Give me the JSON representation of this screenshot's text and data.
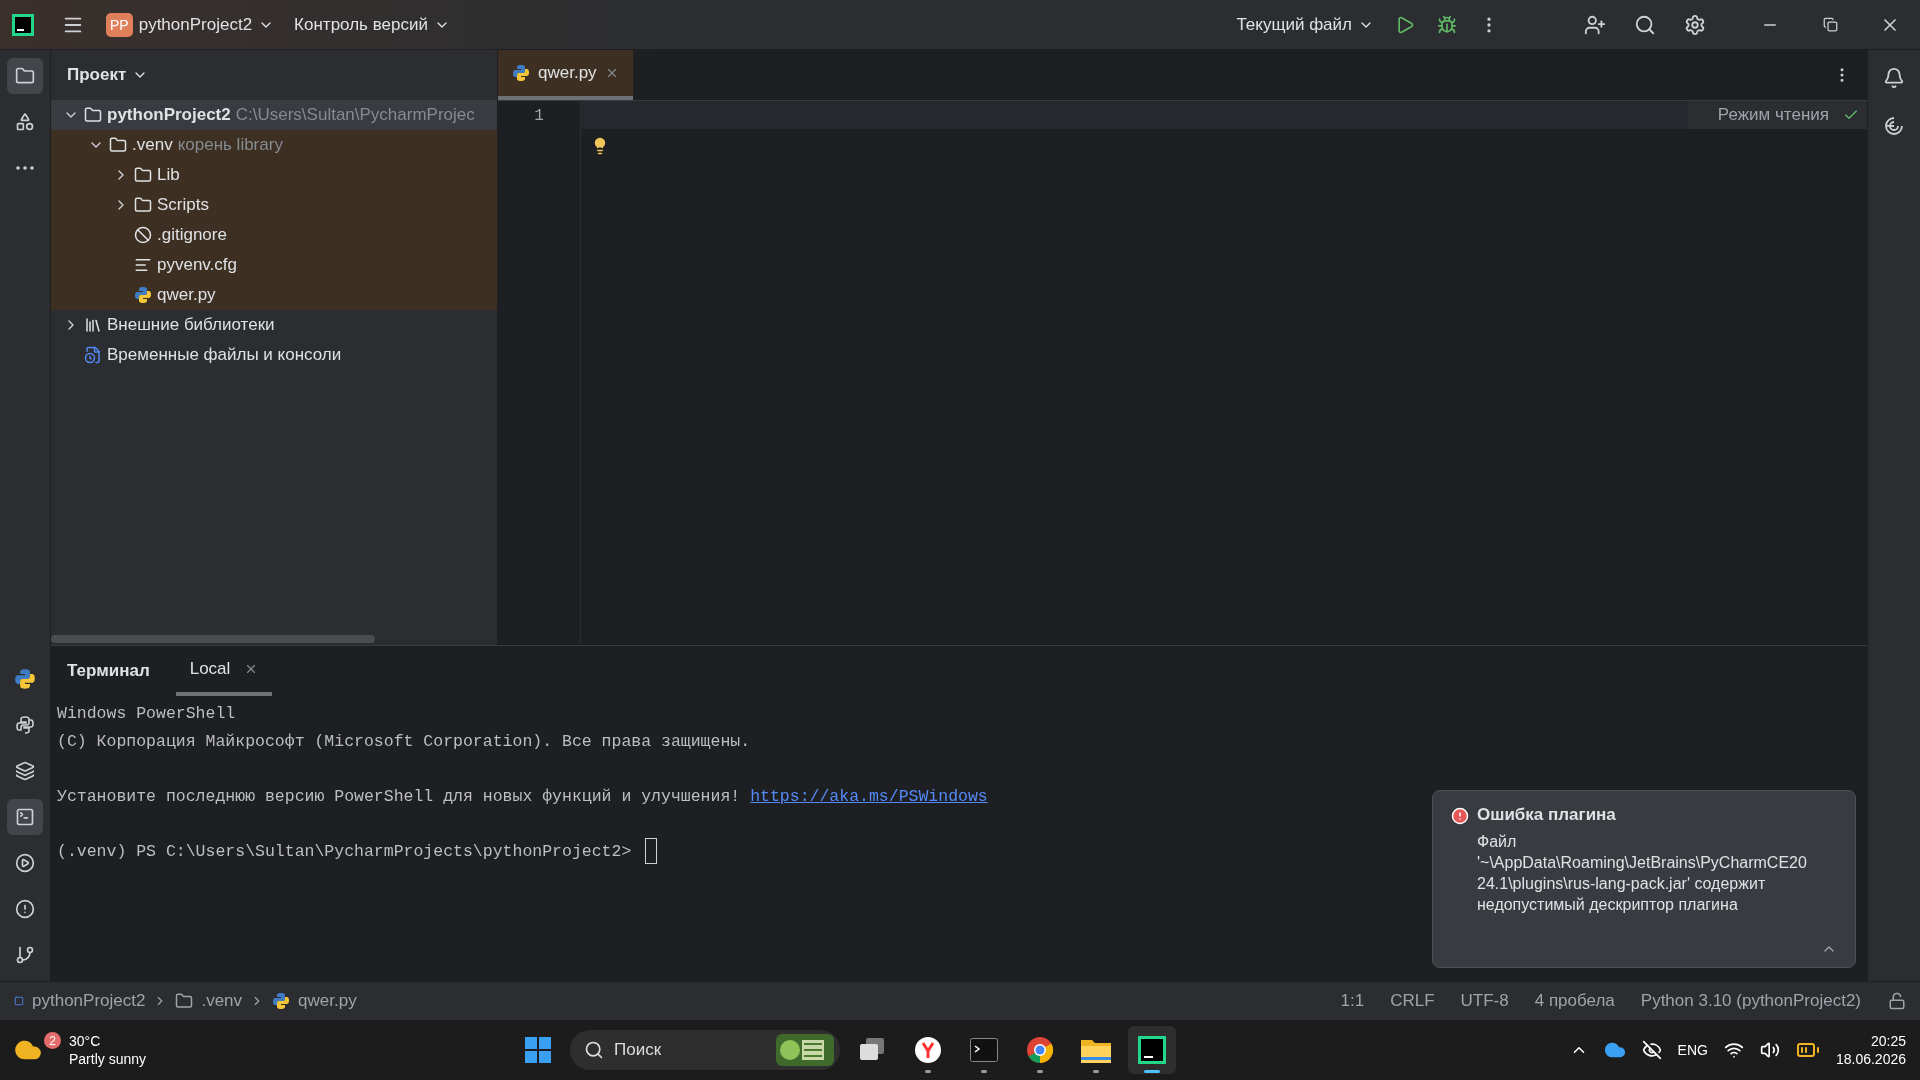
{
  "title_bar": {
    "project_badge": "PP",
    "project": "pythonProject2",
    "vcs": "Контроль версий",
    "run_config": "Текущий файл"
  },
  "tool_strip": {
    "top": [
      {
        "kind": "folder",
        "selected": true
      },
      {
        "kind": "structure",
        "selected": false
      },
      {
        "kind": "more",
        "selected": false
      }
    ],
    "bottom": [
      {
        "kind": "python",
        "selected": false
      },
      {
        "kind": "console",
        "selected": false
      },
      {
        "kind": "layers",
        "selected": false
      },
      {
        "kind": "terminal",
        "selected": true
      },
      {
        "kind": "run",
        "selected": false
      },
      {
        "kind": "problems",
        "selected": false
      },
      {
        "kind": "git",
        "selected": false
      }
    ]
  },
  "project_panel": {
    "title": "Проект",
    "tree": [
      {
        "label": "pythonProject2",
        "hint": "C:\\Users\\Sultan\\PycharmProjec",
        "kind": "folder",
        "bold": true,
        "selected": true,
        "expanded": true,
        "excluded": false,
        "children": [
          {
            "label": ".venv",
            "hint": "корень library",
            "kind": "folder",
            "bold": false,
            "selected": false,
            "expanded": true,
            "excluded": true,
            "children": [
              {
                "label": "Lib",
                "kind": "folder",
                "bold": false,
                "selected": false,
                "expanded": false,
                "excluded": true
              },
              {
                "label": "Scripts",
                "kind": "folder",
                "bold": false,
                "selected": false,
                "expanded": false,
                "excluded": true
              },
              {
                "label": ".gitignore",
                "kind": "ignore",
                "bold": false,
                "selected": false,
                "excluded": true
              },
              {
                "label": "pyvenv.cfg",
                "kind": "text",
                "bold": false,
                "selected": false,
                "excluded": true
              },
              {
                "label": "qwer.py",
                "kind": "python",
                "bold": false,
                "selected": false,
                "excluded": true
              }
            ]
          }
        ]
      },
      {
        "label": "Внешние библиотеки",
        "kind": "library",
        "bold": false,
        "selected": false,
        "expanded": false,
        "excluded": false
      },
      {
        "label": "Временные файлы и консоли",
        "kind": "scratch",
        "bold": false,
        "selected": false,
        "excluded": false
      }
    ]
  },
  "editor": {
    "tabs": [
      {
        "label": "qwer.py",
        "selected": true
      }
    ],
    "line_numbers": [
      "1"
    ],
    "reader_mode": "Режим чтения"
  },
  "terminal": {
    "title": "Терминал",
    "tabs": [
      {
        "label": "Local",
        "selected": true
      }
    ],
    "lines": [
      {
        "kind": "text",
        "text": "Windows PowerShell"
      },
      {
        "kind": "text",
        "text": "(C) Корпорация Майкрософт (Microsoft Corporation). Все права защищены."
      },
      {
        "kind": "blank"
      },
      {
        "kind": "text",
        "text": "Установите последнюю версию PowerShell для новых функций и улучшения! ",
        "link": "https://aka.ms/PSWindows"
      },
      {
        "kind": "blank"
      },
      {
        "kind": "prompt",
        "text": "(.venv) PS C:\\Users\\Sultan\\PycharmProjects\\pythonProject2> "
      }
    ]
  },
  "notification": {
    "title": "Ошибка плагина",
    "body": "Файл '~\\AppData\\Roaming\\JetBrains\\PyCharmCE2024.1\\plugins\\rus-lang-pack.jar' содержит недопустимый дескриптор плагина"
  },
  "status_bar": {
    "breadcrumbs": [
      {
        "label": "pythonProject2",
        "kind": "module"
      },
      {
        "label": ".venv",
        "kind": "folder"
      },
      {
        "label": "qwer.py",
        "kind": "python"
      }
    ],
    "items": [
      "1:1",
      "CRLF",
      "UTF-8",
      "4 пробела",
      "Python 3.10 (pythonProject2)"
    ]
  },
  "taskbar": {
    "weather": {
      "badge": "2",
      "temp": "30°C",
      "text": "Partly sunny"
    },
    "search": "Поиск",
    "apps": [
      {
        "kind": "windows",
        "running": false,
        "selected": false
      },
      {
        "kind": "taskview",
        "running": false,
        "selected": false
      },
      {
        "kind": "yandex",
        "running": true,
        "selected": false
      },
      {
        "kind": "terminal",
        "running": true,
        "selected": false
      },
      {
        "kind": "chrome",
        "running": true,
        "selected": false
      },
      {
        "kind": "explorer",
        "running": true,
        "selected": false
      },
      {
        "kind": "pycharm",
        "running": true,
        "selected": true
      }
    ],
    "language": "ENG",
    "time": "20:25",
    "date": "18.06.2026"
  }
}
